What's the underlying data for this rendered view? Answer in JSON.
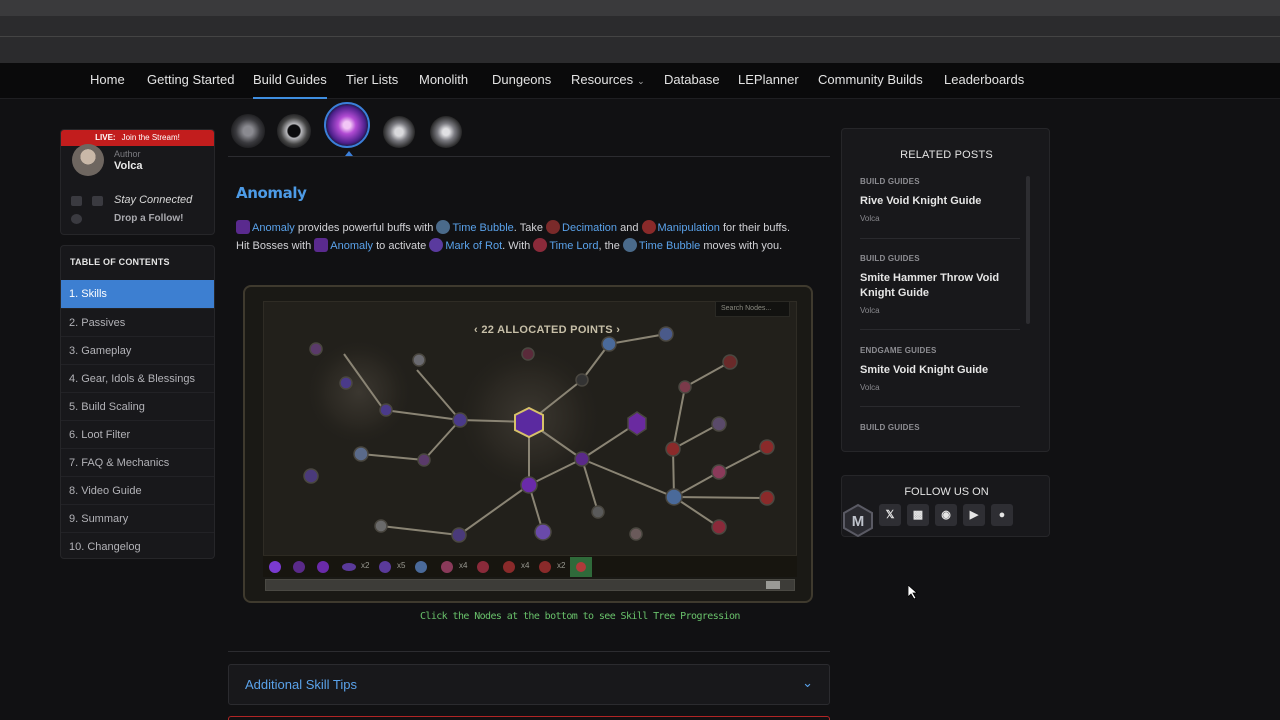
{
  "nav": {
    "items": [
      "Home",
      "Getting Started",
      "Build Guides",
      "Tier Lists",
      "Monolith",
      "Dungeons",
      "Resources",
      "Database",
      "LEPlanner",
      "Community Builds",
      "Leaderboards"
    ],
    "active": "Build Guides"
  },
  "author": {
    "live_label": "LIVE:",
    "live_text": "Join the Stream!",
    "label": "Author",
    "name": "Volca",
    "stay": "Stay Connected",
    "drop": "Drop a Follow!"
  },
  "toc": {
    "title": "TABLE OF CONTENTS",
    "items": [
      "1. Skills",
      "2. Passives",
      "3. Gameplay",
      "4. Gear, Idols & Blessings",
      "5. Build Scaling",
      "6. Loot Filter",
      "7. FAQ & Mechanics",
      "8. Video Guide",
      "9. Summary",
      "10. Changelog"
    ]
  },
  "main": {
    "heading": "Anomaly",
    "line1": {
      "a": "Anomaly",
      "b": " provides powerful buffs with ",
      "c": "Time Bubble",
      "d": ". Take ",
      "e": "Decimation",
      "f": " and ",
      "g": "Manipulation",
      "h": " for their buffs."
    },
    "line2": {
      "a": "Hit Bosses with ",
      "b": "Anomaly",
      "c": " to activate ",
      "d": "Mark of Rot",
      "e": ". With ",
      "f": "Time Lord",
      "g": ", the ",
      "h": "Time Bubble",
      "i": " moves with you."
    },
    "tree": {
      "allocated": "22 ALLOCATED POINTS",
      "search_placeholder": "Search Nodes...",
      "bar_counts": [
        "x2",
        "x5",
        "x4",
        "x4",
        "x2"
      ]
    },
    "caption": "Click the Nodes at the bottom to see Skill Tree Progression",
    "accordion_title": "Additional Skill Tips"
  },
  "related": {
    "title": "RELATED POSTS",
    "posts": [
      {
        "category": "BUILD GUIDES",
        "title": "Rive Void Knight Guide",
        "author": "Volca"
      },
      {
        "category": "BUILD GUIDES",
        "title": "Smite Hammer Throw Void Knight Guide",
        "author": "Volca"
      },
      {
        "category": "ENDGAME GUIDES",
        "title": "Smite Void Knight Guide",
        "author": "Volca"
      },
      {
        "category": "BUILD GUIDES"
      }
    ]
  },
  "follow": {
    "title": "FOLLOW US ON",
    "icons": [
      "x-icon",
      "twitch-icon",
      "instagram-icon",
      "youtube-icon",
      "discord-icon"
    ]
  },
  "colors": {
    "accent": "#3d7fd1",
    "link": "#5aa2ea",
    "live": "#c21d1d",
    "caption": "#69c26b"
  }
}
